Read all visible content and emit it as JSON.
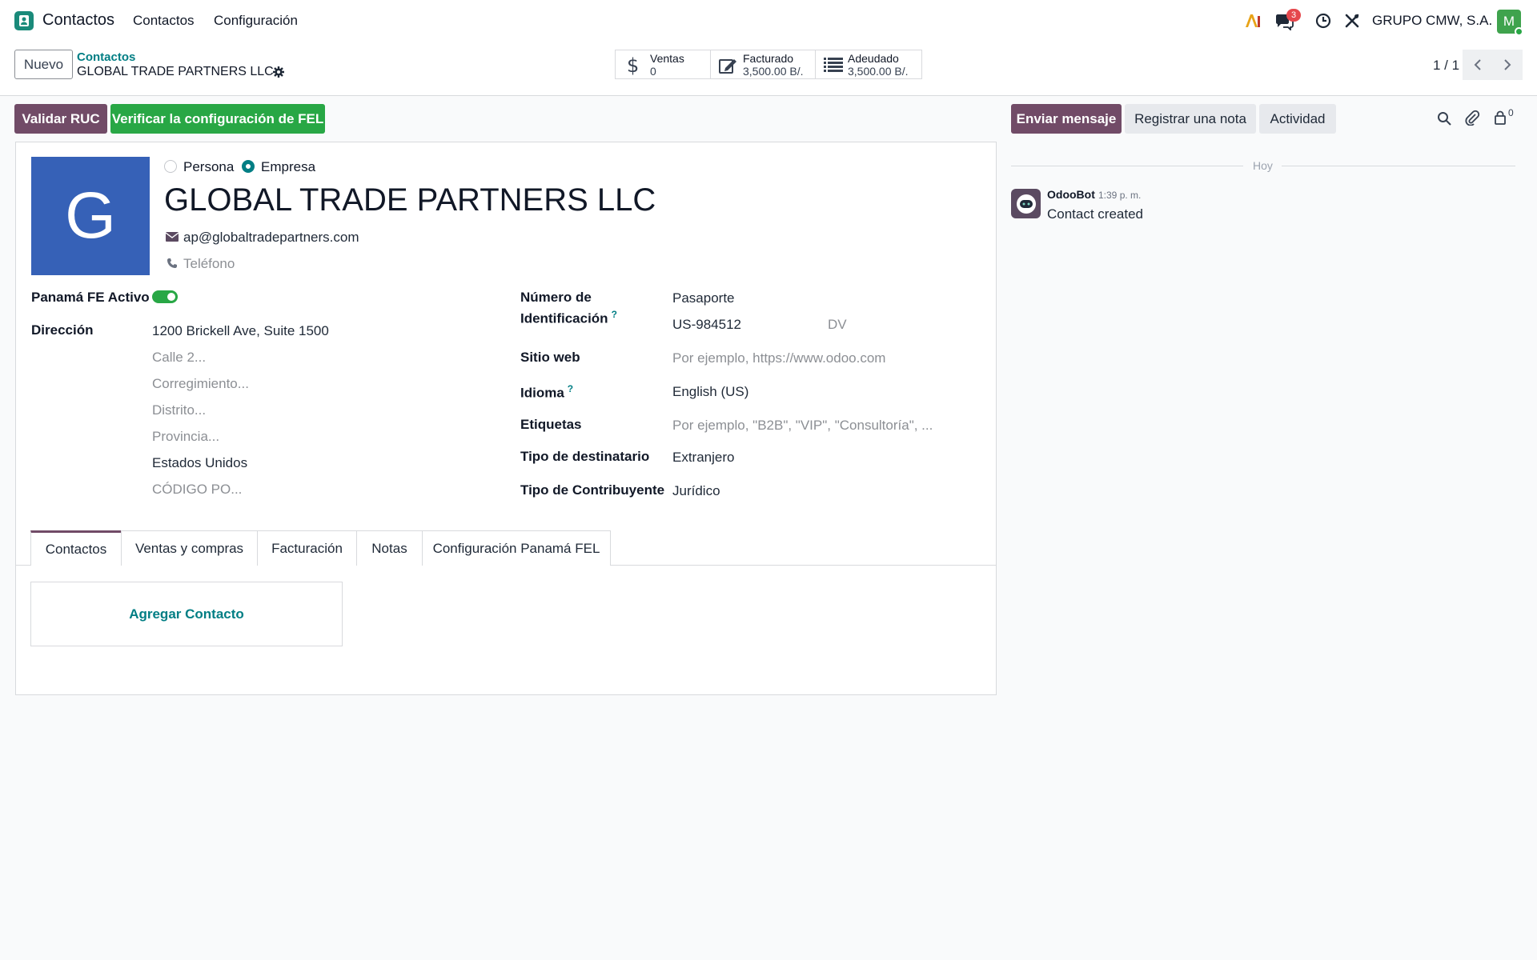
{
  "navbar": {
    "app_name": "Contactos",
    "menu": [
      "Contactos",
      "Configuración"
    ],
    "messages_badge": "3",
    "company": "GRUPO CMW, S.A.",
    "user_initial": "M",
    "colors": {
      "app_icon": "#1a8a7a",
      "badge": "#e5484d",
      "avatar": "#3fa34d"
    }
  },
  "control": {
    "new_button": "Nuevo",
    "breadcrumb_parent": "Contactos",
    "breadcrumb_current": "GLOBAL TRADE PARTNERS LLC",
    "smart_buttons": [
      {
        "icon": "dollar-icon",
        "label": "Ventas",
        "value": "0"
      },
      {
        "icon": "edit-icon",
        "label": "Facturado",
        "value": "3,500.00 B/."
      },
      {
        "icon": "list-icon",
        "label": "Adeudado",
        "value": "3,500.00 B/."
      }
    ],
    "pager": "1 / 1"
  },
  "actions": {
    "validar_ruc": "Validar RUC",
    "verificar_fel": "Verificar la configuración de FEL"
  },
  "chatter": {
    "send_message": "Enviar mensaje",
    "log_note": "Registrar una nota",
    "activity": "Actividad",
    "followers_count": "0",
    "date_separator": "Hoy",
    "messages": [
      {
        "author": "OdooBot",
        "time": "1:39 p. m.",
        "body": "Contact created"
      }
    ]
  },
  "form": {
    "avatar_letter": "G",
    "company_type": {
      "persona": "Persona",
      "empresa": "Empresa",
      "selected": "Empresa"
    },
    "name": "GLOBAL TRADE PARTNERS LLC",
    "email": "ap@globaltradepartners.com",
    "phone_placeholder": "Teléfono",
    "fe_active_label": "Panamá FE Activo",
    "fe_active": true,
    "address_label": "Dirección",
    "address": {
      "street": "1200 Brickell Ave, Suite 1500",
      "street2_placeholder": "Calle 2...",
      "corregimiento_placeholder": "Corregimiento...",
      "distrito_placeholder": "Distrito...",
      "provincia_placeholder": "Provincia...",
      "country": "Estados Unidos",
      "zip_placeholder": "CÓDIGO PO..."
    },
    "id_label_line1": "Número de",
    "id_label_line2": "Identificación",
    "id_type": "Pasaporte",
    "id_number": "US-984512",
    "dv_placeholder": "DV",
    "website_label": "Sitio web",
    "website_placeholder": "Por ejemplo, https://www.odoo.com",
    "language_label": "Idioma",
    "language": "English (US)",
    "tags_label": "Etiquetas",
    "tags_placeholder": "Por ejemplo, \"B2B\", \"VIP\", \"Consultoría\", ...",
    "recipient_type_label": "Tipo de destinatario",
    "recipient_type": "Extranjero",
    "taxpayer_type_label": "Tipo de Contribuyente",
    "taxpayer_type": "Jurídico",
    "help_mark": "?",
    "tabs": [
      "Contactos",
      "Ventas y compras",
      "Facturación",
      "Notas",
      "Configuración Panamá FEL"
    ],
    "active_tab": "Contactos",
    "add_contact": "Agregar Contacto"
  }
}
